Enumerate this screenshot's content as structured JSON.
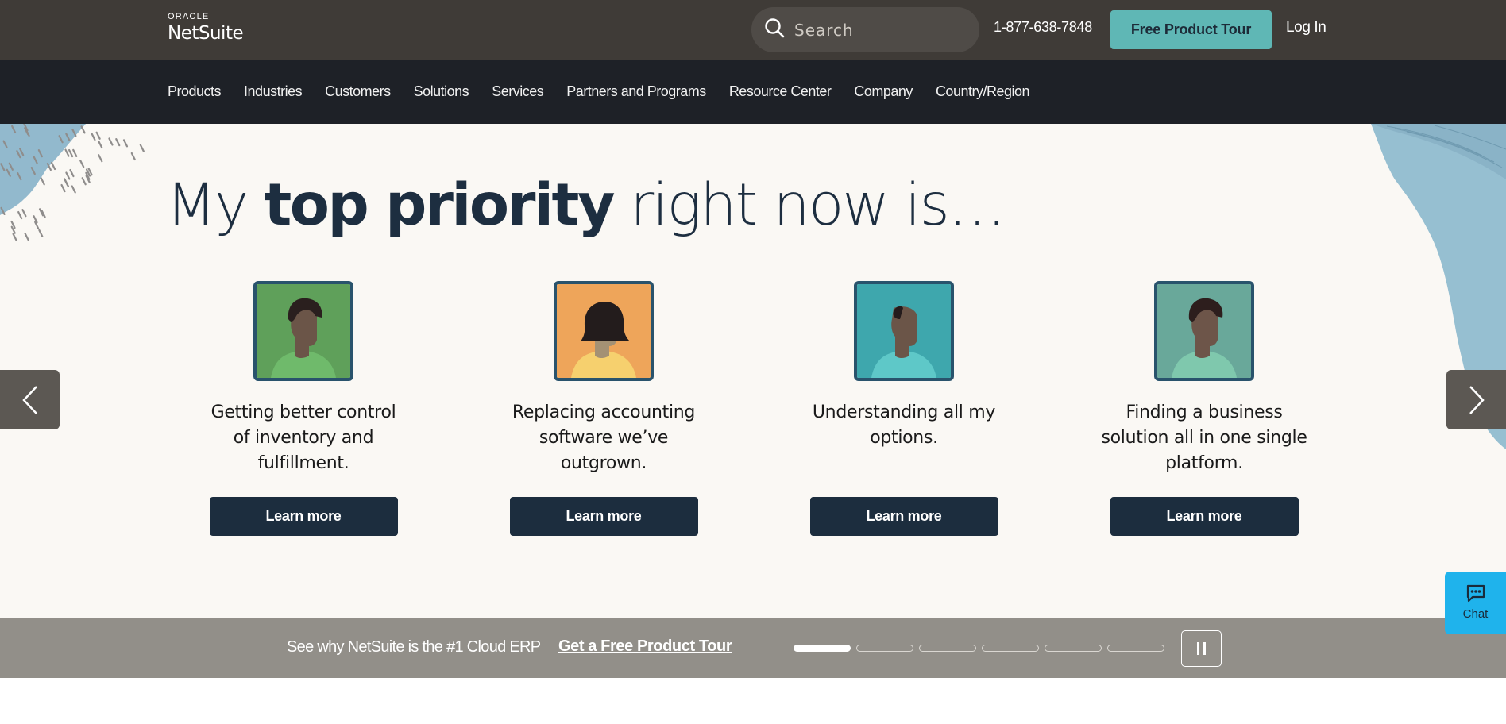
{
  "header": {
    "logo_top": "ORACLE",
    "logo_main": "NetSuite",
    "search_placeholder": "Search",
    "phone": "1-877-638-7848",
    "tour_button": "Free Product Tour",
    "login": "Log In"
  },
  "nav": {
    "items": [
      {
        "label": "Products"
      },
      {
        "label": "Industries"
      },
      {
        "label": "Customers"
      },
      {
        "label": "Solutions"
      },
      {
        "label": "Services"
      },
      {
        "label": "Partners and Programs"
      },
      {
        "label": "Resource Center"
      },
      {
        "label": "Company"
      },
      {
        "label": "Country/Region"
      }
    ]
  },
  "hero": {
    "headline_pre": "My ",
    "headline_bold": "top priority",
    "headline_post": " right now is…",
    "cards": [
      {
        "caption": "Getting better control of inventory and fulfillment.",
        "button": "Learn more",
        "portrait_bg": "#5fa05a",
        "shirt": "#6fba6b",
        "skin": "#6b5548",
        "hair": "#2a1f1e"
      },
      {
        "caption": "Replacing accounting software we’ve outgrown.",
        "button": "Learn more",
        "portrait_bg": "#eea55a",
        "shirt": "#f6d06e",
        "skin": "#a49174",
        "hair": "#231c1c"
      },
      {
        "caption": "Understanding all my options.",
        "button": "Learn more",
        "portrait_bg": "#3ea7ad",
        "shirt": "#5ec8c8",
        "skin": "#6b5548",
        "hair": "#241b1c"
      },
      {
        "caption": "Finding a business solution all in one single platform.",
        "button": "Learn more",
        "portrait_bg": "#69a89a",
        "shirt": "#7fc8ad",
        "skin": "#6d5549",
        "hair": "#2d1e1d"
      }
    ],
    "prev_label": "Previous slide",
    "next_label": "Next slide"
  },
  "promo": {
    "text": "See why NetSuite is the #1 Cloud ERP",
    "link": "Get a Free Product Tour",
    "slides_total": 6,
    "slide_active": 1,
    "pause_label": "Pause"
  },
  "chat": {
    "label": "Chat"
  },
  "colors": {
    "topbar": "#3f3b37",
    "nav": "#1e2127",
    "accent_teal": "#5fb7b5",
    "navy": "#1c2d3e",
    "promo": "#928f89",
    "chat": "#1fb3ec"
  }
}
